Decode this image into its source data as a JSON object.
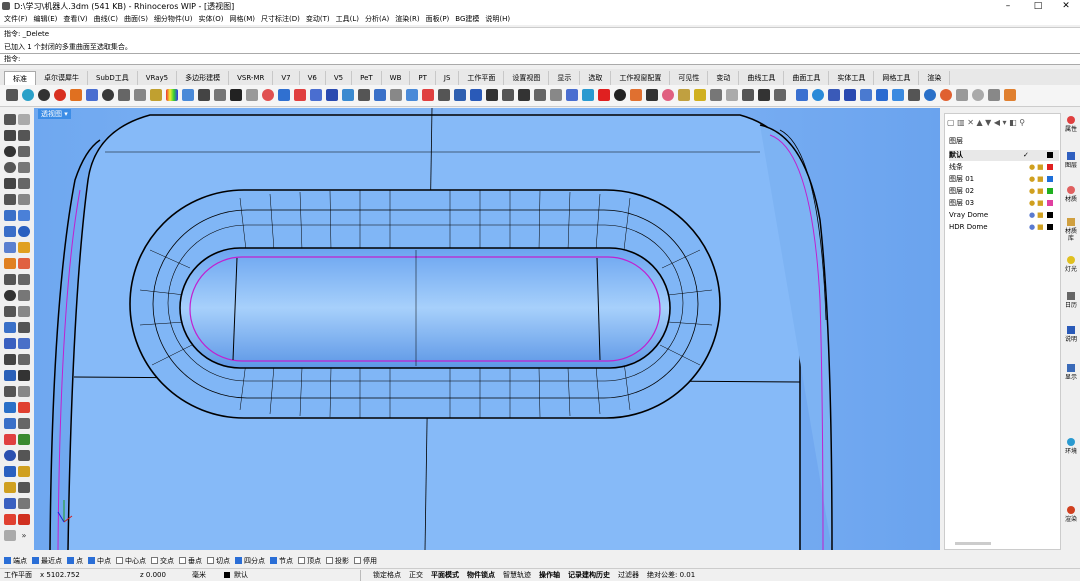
{
  "window": {
    "title": "D:\\学习\\机器人.3dm (541 KB) - Rhinoceros WIP - [透视图]"
  },
  "menu": [
    "文件(F)",
    "编辑(E)",
    "查看(V)",
    "曲线(C)",
    "曲面(S)",
    "细分物件(U)",
    "实体(O)",
    "网格(M)",
    "尺寸标注(D)",
    "变动(T)",
    "工具(L)",
    "分析(A)",
    "渲染(R)",
    "面板(P)",
    "BG建模",
    "说明(H)"
  ],
  "command": {
    "history": [
      "指令: _Delete",
      "已加入 1 个封闭的多重曲面至选取集合。"
    ],
    "prompt": "指令:"
  },
  "tabs": [
    "标准",
    "卓尔谟犀牛",
    "SubD工具",
    "VRay5",
    "多边形建模",
    "VSR-MR",
    "V7",
    "V6",
    "V5",
    "PeT",
    "WB",
    "PT",
    "JS",
    "工作平面",
    "设置视图",
    "显示",
    "选取",
    "工作视窗配置",
    "可见性",
    "变动",
    "曲线工具",
    "曲面工具",
    "实体工具",
    "网格工具",
    "渲染"
  ],
  "viewport": {
    "label": "透视图"
  },
  "layers": {
    "header": "图层",
    "rows": [
      {
        "name": "默认",
        "color": "#000000"
      },
      {
        "name": "线条",
        "color": "#e02020"
      },
      {
        "name": "图层 01",
        "color": "#1e6fd9"
      },
      {
        "name": "图层 02",
        "color": "#20b020"
      },
      {
        "name": "图层 03",
        "color": "#e040a0"
      },
      {
        "name": "Vray Dome",
        "color": "#000000"
      },
      {
        "name": "HDR Dome",
        "color": "#000000"
      }
    ]
  },
  "side_tabs": [
    "属性",
    "图层",
    "材质",
    "材质库",
    "灯光",
    "日历",
    "说明",
    "显示",
    "环境",
    "渲染"
  ],
  "osnap": [
    {
      "label": "端点",
      "on": true
    },
    {
      "label": "最近点",
      "on": true
    },
    {
      "label": "点",
      "on": true
    },
    {
      "label": "中点",
      "on": true
    },
    {
      "label": "中心点",
      "on": false
    },
    {
      "label": "交点",
      "on": false
    },
    {
      "label": "垂点",
      "on": false
    },
    {
      "label": "切点",
      "on": false
    },
    {
      "label": "四分点",
      "on": true
    },
    {
      "label": "节点",
      "on": true
    },
    {
      "label": "顶点",
      "on": false
    },
    {
      "label": "投影",
      "on": false
    },
    {
      "label": "停用",
      "on": false
    }
  ],
  "status": {
    "cplane": "工作平面",
    "x": "x 5102.752",
    "z": "z 0.000",
    "unit": "毫米",
    "layer": "默认",
    "toggles": [
      "锁定格点",
      "正交",
      "平面模式",
      "物件锁点",
      "智慧轨迹",
      "操作轴",
      "记录建构历史",
      "过滤器"
    ],
    "tolerance": "绝对公差: 0.01"
  }
}
